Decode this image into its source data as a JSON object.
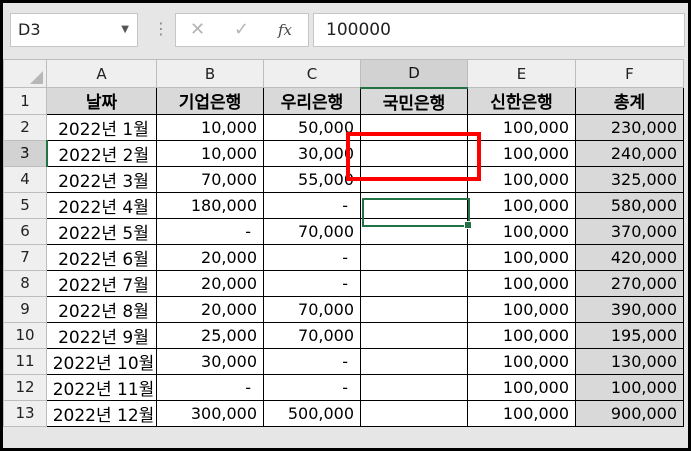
{
  "name_box": "D3",
  "formula_bar": {
    "value": "100000",
    "cancel": "✕",
    "enter": "✓",
    "fx": "fx"
  },
  "columns": [
    "A",
    "B",
    "C",
    "D",
    "E",
    "F"
  ],
  "selected_column": "D",
  "selected_row": "3",
  "headers": [
    "날짜",
    "기업은행",
    "우리은행",
    "국민은행",
    "신한은행",
    "총계"
  ],
  "rows": [
    {
      "n": "2",
      "c": [
        "2022년 1월",
        "10,000",
        "50,000",
        "",
        "100,000",
        "230,000"
      ]
    },
    {
      "n": "3",
      "c": [
        "2022년 2월",
        "10,000",
        "30,000",
        "",
        "100,000",
        "240,000"
      ]
    },
    {
      "n": "4",
      "c": [
        "2022년 3월",
        "70,000",
        "55,000",
        "",
        "100,000",
        "325,000"
      ]
    },
    {
      "n": "5",
      "c": [
        "2022년 4월",
        "180,000",
        "-",
        "",
        "100,000",
        "580,000"
      ]
    },
    {
      "n": "6",
      "c": [
        "2022년 5월",
        "-",
        "70,000",
        "",
        "100,000",
        "370,000"
      ]
    },
    {
      "n": "7",
      "c": [
        "2022년 6월",
        "20,000",
        "-",
        "",
        "100,000",
        "420,000"
      ]
    },
    {
      "n": "8",
      "c": [
        "2022년 7월",
        "20,000",
        "-",
        "",
        "100,000",
        "270,000"
      ]
    },
    {
      "n": "9",
      "c": [
        "2022년 8월",
        "20,000",
        "70,000",
        "",
        "100,000",
        "390,000"
      ]
    },
    {
      "n": "10",
      "c": [
        "2022년 9월",
        "25,000",
        "70,000",
        "",
        "100,000",
        "195,000"
      ]
    },
    {
      "n": "11",
      "c": [
        "2022년 10월",
        "30,000",
        "-",
        "",
        "100,000",
        "130,000"
      ]
    },
    {
      "n": "12",
      "c": [
        "2022년 11월",
        "-",
        "-",
        "",
        "100,000",
        "100,000"
      ]
    },
    {
      "n": "13",
      "c": [
        "2022년 12월",
        "300,000",
        "500,000",
        "",
        "100,000",
        "900,000"
      ]
    }
  ],
  "colors": {
    "accent": "#217346",
    "highlight": "#ff0000",
    "header_fill": "#d9d9d9"
  }
}
